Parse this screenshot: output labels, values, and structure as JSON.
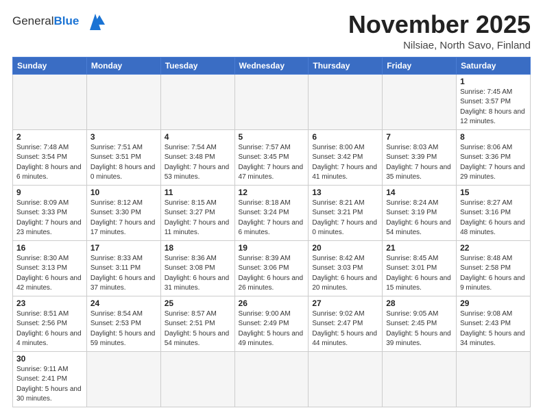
{
  "logo": {
    "general": "General",
    "blue": "Blue"
  },
  "title": "November 2025",
  "subtitle": "Nilsiae, North Savo, Finland",
  "weekdays": [
    "Sunday",
    "Monday",
    "Tuesday",
    "Wednesday",
    "Thursday",
    "Friday",
    "Saturday"
  ],
  "weeks": [
    [
      {
        "day": "",
        "info": ""
      },
      {
        "day": "",
        "info": ""
      },
      {
        "day": "",
        "info": ""
      },
      {
        "day": "",
        "info": ""
      },
      {
        "day": "",
        "info": ""
      },
      {
        "day": "",
        "info": ""
      },
      {
        "day": "1",
        "info": "Sunrise: 7:45 AM\nSunset: 3:57 PM\nDaylight: 8 hours\nand 12 minutes."
      }
    ],
    [
      {
        "day": "2",
        "info": "Sunrise: 7:48 AM\nSunset: 3:54 PM\nDaylight: 8 hours\nand 6 minutes."
      },
      {
        "day": "3",
        "info": "Sunrise: 7:51 AM\nSunset: 3:51 PM\nDaylight: 8 hours\nand 0 minutes."
      },
      {
        "day": "4",
        "info": "Sunrise: 7:54 AM\nSunset: 3:48 PM\nDaylight: 7 hours\nand 53 minutes."
      },
      {
        "day": "5",
        "info": "Sunrise: 7:57 AM\nSunset: 3:45 PM\nDaylight: 7 hours\nand 47 minutes."
      },
      {
        "day": "6",
        "info": "Sunrise: 8:00 AM\nSunset: 3:42 PM\nDaylight: 7 hours\nand 41 minutes."
      },
      {
        "day": "7",
        "info": "Sunrise: 8:03 AM\nSunset: 3:39 PM\nDaylight: 7 hours\nand 35 minutes."
      },
      {
        "day": "8",
        "info": "Sunrise: 8:06 AM\nSunset: 3:36 PM\nDaylight: 7 hours\nand 29 minutes."
      }
    ],
    [
      {
        "day": "9",
        "info": "Sunrise: 8:09 AM\nSunset: 3:33 PM\nDaylight: 7 hours\nand 23 minutes."
      },
      {
        "day": "10",
        "info": "Sunrise: 8:12 AM\nSunset: 3:30 PM\nDaylight: 7 hours\nand 17 minutes."
      },
      {
        "day": "11",
        "info": "Sunrise: 8:15 AM\nSunset: 3:27 PM\nDaylight: 7 hours\nand 11 minutes."
      },
      {
        "day": "12",
        "info": "Sunrise: 8:18 AM\nSunset: 3:24 PM\nDaylight: 7 hours\nand 6 minutes."
      },
      {
        "day": "13",
        "info": "Sunrise: 8:21 AM\nSunset: 3:21 PM\nDaylight: 7 hours\nand 0 minutes."
      },
      {
        "day": "14",
        "info": "Sunrise: 8:24 AM\nSunset: 3:19 PM\nDaylight: 6 hours\nand 54 minutes."
      },
      {
        "day": "15",
        "info": "Sunrise: 8:27 AM\nSunset: 3:16 PM\nDaylight: 6 hours\nand 48 minutes."
      }
    ],
    [
      {
        "day": "16",
        "info": "Sunrise: 8:30 AM\nSunset: 3:13 PM\nDaylight: 6 hours\nand 42 minutes."
      },
      {
        "day": "17",
        "info": "Sunrise: 8:33 AM\nSunset: 3:11 PM\nDaylight: 6 hours\nand 37 minutes."
      },
      {
        "day": "18",
        "info": "Sunrise: 8:36 AM\nSunset: 3:08 PM\nDaylight: 6 hours\nand 31 minutes."
      },
      {
        "day": "19",
        "info": "Sunrise: 8:39 AM\nSunset: 3:06 PM\nDaylight: 6 hours\nand 26 minutes."
      },
      {
        "day": "20",
        "info": "Sunrise: 8:42 AM\nSunset: 3:03 PM\nDaylight: 6 hours\nand 20 minutes."
      },
      {
        "day": "21",
        "info": "Sunrise: 8:45 AM\nSunset: 3:01 PM\nDaylight: 6 hours\nand 15 minutes."
      },
      {
        "day": "22",
        "info": "Sunrise: 8:48 AM\nSunset: 2:58 PM\nDaylight: 6 hours\nand 9 minutes."
      }
    ],
    [
      {
        "day": "23",
        "info": "Sunrise: 8:51 AM\nSunset: 2:56 PM\nDaylight: 6 hours\nand 4 minutes."
      },
      {
        "day": "24",
        "info": "Sunrise: 8:54 AM\nSunset: 2:53 PM\nDaylight: 5 hours\nand 59 minutes."
      },
      {
        "day": "25",
        "info": "Sunrise: 8:57 AM\nSunset: 2:51 PM\nDaylight: 5 hours\nand 54 minutes."
      },
      {
        "day": "26",
        "info": "Sunrise: 9:00 AM\nSunset: 2:49 PM\nDaylight: 5 hours\nand 49 minutes."
      },
      {
        "day": "27",
        "info": "Sunrise: 9:02 AM\nSunset: 2:47 PM\nDaylight: 5 hours\nand 44 minutes."
      },
      {
        "day": "28",
        "info": "Sunrise: 9:05 AM\nSunset: 2:45 PM\nDaylight: 5 hours\nand 39 minutes."
      },
      {
        "day": "29",
        "info": "Sunrise: 9:08 AM\nSunset: 2:43 PM\nDaylight: 5 hours\nand 34 minutes."
      }
    ],
    [
      {
        "day": "30",
        "info": "Sunrise: 9:11 AM\nSunset: 2:41 PM\nDaylight: 5 hours\nand 30 minutes."
      },
      {
        "day": "",
        "info": ""
      },
      {
        "day": "",
        "info": ""
      },
      {
        "day": "",
        "info": ""
      },
      {
        "day": "",
        "info": ""
      },
      {
        "day": "",
        "info": ""
      },
      {
        "day": "",
        "info": ""
      }
    ]
  ]
}
